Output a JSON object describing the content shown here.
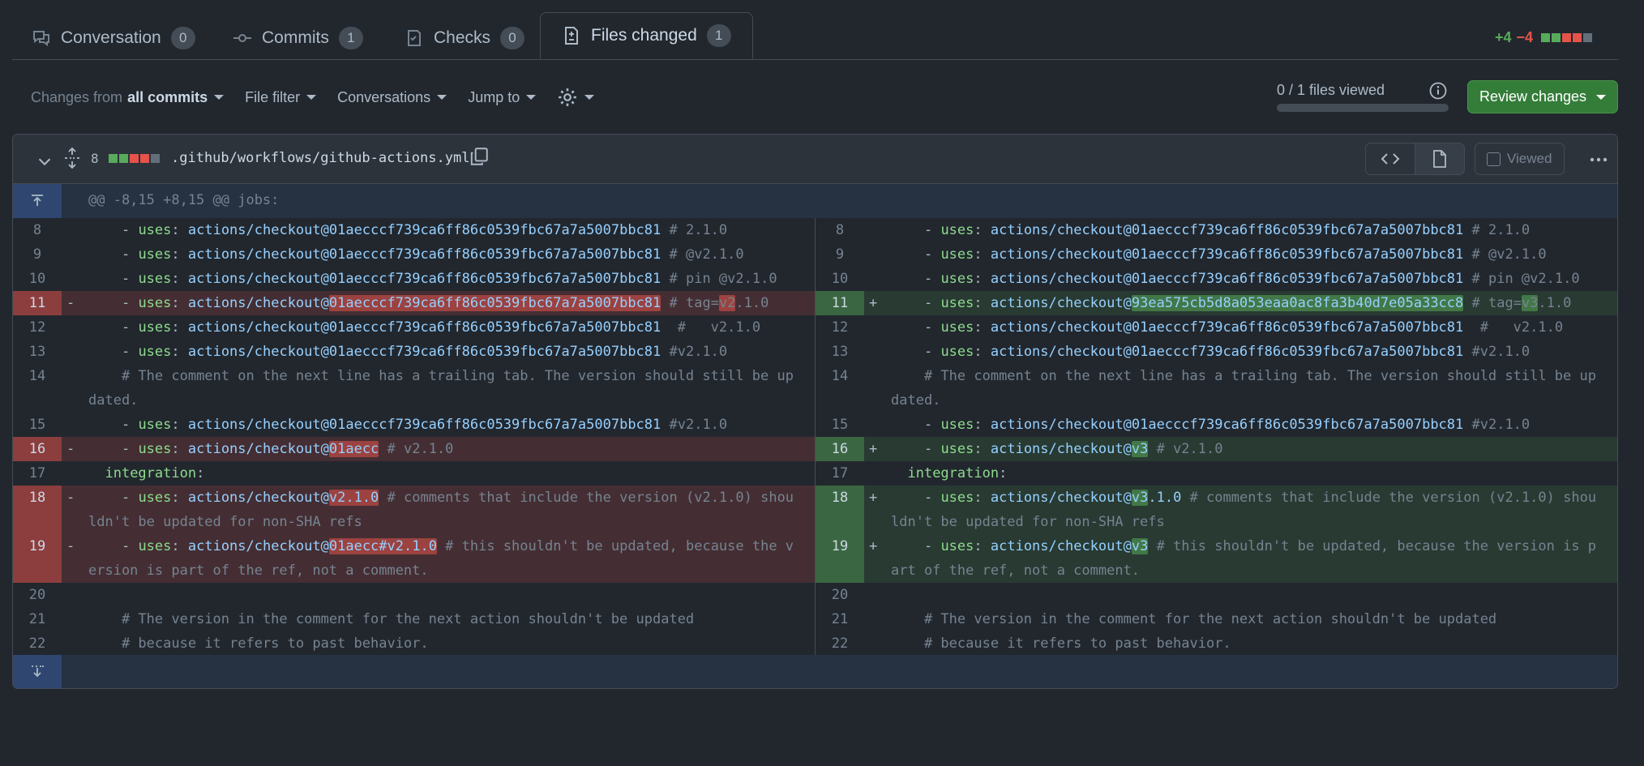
{
  "tabs": [
    {
      "label": "Conversation",
      "count": "0",
      "icon": "comment-discussion-icon"
    },
    {
      "label": "Commits",
      "count": "1",
      "icon": "git-commit-icon"
    },
    {
      "label": "Checks",
      "count": "0",
      "icon": "checklist-icon"
    },
    {
      "label": "Files changed",
      "count": "1",
      "icon": "file-diff-icon",
      "active": true
    }
  ],
  "diffstat": {
    "additions": "+4",
    "deletions": "−4"
  },
  "toolbar": {
    "changes_prefix": "Changes from",
    "changes_value": "all commits",
    "file_filter": "File filter",
    "conversations": "Conversations",
    "jump_to": "Jump to"
  },
  "files_viewed": {
    "label": "0 / 1 files viewed",
    "fraction": 0
  },
  "review_button": "Review changes",
  "file": {
    "change_count": "8",
    "path": ".github/workflows/github-actions.yml",
    "viewed_label": "Viewed"
  },
  "hunk_header": "@@ -8,15 +8,15 @@ jobs:",
  "lines_left": [
    {
      "n": "8",
      "t": "ctx",
      "parts": [
        [
          "p",
          "    - "
        ],
        [
          "k",
          "uses"
        ],
        [
          "p",
          ": "
        ],
        [
          "s",
          "actions/checkout@01aecccf739ca6ff86c0539fbc67a7a5007bbc81"
        ],
        [
          "c",
          " # 2.1.0"
        ]
      ]
    },
    {
      "n": "9",
      "t": "ctx",
      "parts": [
        [
          "p",
          "    - "
        ],
        [
          "k",
          "uses"
        ],
        [
          "p",
          ": "
        ],
        [
          "s",
          "actions/checkout@01aecccf739ca6ff86c0539fbc67a7a5007bbc81"
        ],
        [
          "c",
          " # @v2.1.0"
        ]
      ]
    },
    {
      "n": "10",
      "t": "ctx",
      "parts": [
        [
          "p",
          "    - "
        ],
        [
          "k",
          "uses"
        ],
        [
          "p",
          ": "
        ],
        [
          "s",
          "actions/checkout@01aecccf739ca6ff86c0539fbc67a7a5007bbc81"
        ],
        [
          "c",
          " # pin @v2.1.0"
        ]
      ]
    },
    {
      "n": "11",
      "t": "del",
      "parts": [
        [
          "p",
          "    - "
        ],
        [
          "k",
          "uses"
        ],
        [
          "p",
          ": "
        ],
        [
          "s",
          "actions/checkout@"
        ],
        [
          "sd",
          "01aecccf739ca6ff86c0539fbc67a7a5007bbc81"
        ],
        [
          "c",
          " # tag="
        ],
        [
          "cd",
          "v2"
        ],
        [
          "c",
          ".1.0"
        ]
      ]
    },
    {
      "n": "12",
      "t": "ctx",
      "parts": [
        [
          "p",
          "    - "
        ],
        [
          "k",
          "uses"
        ],
        [
          "p",
          ": "
        ],
        [
          "s",
          "actions/checkout@01aecccf739ca6ff86c0539fbc67a7a5007bbc81"
        ],
        [
          "c",
          "  #   v2.1.0"
        ]
      ]
    },
    {
      "n": "13",
      "t": "ctx",
      "parts": [
        [
          "p",
          "    - "
        ],
        [
          "k",
          "uses"
        ],
        [
          "p",
          ": "
        ],
        [
          "s",
          "actions/checkout@01aecccf739ca6ff86c0539fbc67a7a5007bbc81"
        ],
        [
          "c",
          " #v2.1.0"
        ]
      ]
    },
    {
      "n": "14",
      "t": "ctx",
      "rows": 2,
      "parts": [
        [
          "c",
          "    # The comment on the next line has a trailing tab. The version should still be updated."
        ]
      ]
    },
    {
      "n": "15",
      "t": "ctx",
      "parts": [
        [
          "p",
          "    - "
        ],
        [
          "k",
          "uses"
        ],
        [
          "p",
          ": "
        ],
        [
          "s",
          "actions/checkout@01aecccf739ca6ff86c0539fbc67a7a5007bbc81"
        ],
        [
          "c",
          " #v2.1.0"
        ]
      ]
    },
    {
      "n": "16",
      "t": "del",
      "parts": [
        [
          "p",
          "    - "
        ],
        [
          "k",
          "uses"
        ],
        [
          "p",
          ": "
        ],
        [
          "s",
          "actions/checkout@"
        ],
        [
          "sd",
          "01aecc"
        ],
        [
          "c",
          " # v2.1.0"
        ]
      ]
    },
    {
      "n": "17",
      "t": "ctx",
      "parts": [
        [
          "p",
          "  "
        ],
        [
          "k",
          "integration"
        ],
        [
          "p",
          ":"
        ]
      ]
    },
    {
      "n": "18",
      "t": "del",
      "rows": 2,
      "parts": [
        [
          "p",
          "    - "
        ],
        [
          "k",
          "uses"
        ],
        [
          "p",
          ": "
        ],
        [
          "s",
          "actions/checkout@"
        ],
        [
          "sd",
          "v2.1.0"
        ],
        [
          "c",
          " # comments that include the version (v2.1.0) shouldn't be updated for non-SHA refs"
        ]
      ]
    },
    {
      "n": "19",
      "t": "del",
      "rows": 2,
      "parts": [
        [
          "p",
          "    - "
        ],
        [
          "k",
          "uses"
        ],
        [
          "p",
          ": "
        ],
        [
          "s",
          "actions/checkout@"
        ],
        [
          "sd",
          "01aecc#v2.1.0"
        ],
        [
          "c",
          " # this shouldn't be updated, because the version is part of the ref, not a comment."
        ]
      ]
    },
    {
      "n": "20",
      "t": "ctx",
      "parts": [
        [
          "p",
          ""
        ]
      ]
    },
    {
      "n": "21",
      "t": "ctx",
      "parts": [
        [
          "c",
          "    # The version in the comment for the next action shouldn't be updated"
        ]
      ]
    },
    {
      "n": "22",
      "t": "ctx",
      "parts": [
        [
          "c",
          "    # because it refers to past behavior."
        ]
      ]
    }
  ],
  "lines_right": [
    {
      "n": "8",
      "t": "ctx",
      "parts": [
        [
          "p",
          "    - "
        ],
        [
          "k",
          "uses"
        ],
        [
          "p",
          ": "
        ],
        [
          "s",
          "actions/checkout@01aecccf739ca6ff86c0539fbc67a7a5007bbc81"
        ],
        [
          "c",
          " # 2.1.0"
        ]
      ]
    },
    {
      "n": "9",
      "t": "ctx",
      "parts": [
        [
          "p",
          "    - "
        ],
        [
          "k",
          "uses"
        ],
        [
          "p",
          ": "
        ],
        [
          "s",
          "actions/checkout@01aecccf739ca6ff86c0539fbc67a7a5007bbc81"
        ],
        [
          "c",
          " # @v2.1.0"
        ]
      ]
    },
    {
      "n": "10",
      "t": "ctx",
      "parts": [
        [
          "p",
          "    - "
        ],
        [
          "k",
          "uses"
        ],
        [
          "p",
          ": "
        ],
        [
          "s",
          "actions/checkout@01aecccf739ca6ff86c0539fbc67a7a5007bbc81"
        ],
        [
          "c",
          " # pin @v2.1.0"
        ]
      ]
    },
    {
      "n": "11",
      "t": "add",
      "parts": [
        [
          "p",
          "    - "
        ],
        [
          "k",
          "uses"
        ],
        [
          "p",
          ": "
        ],
        [
          "s",
          "actions/checkout@"
        ],
        [
          "sa",
          "93ea575cb5d8a053eaa0ac8fa3b40d7e05a33cc8"
        ],
        [
          "c",
          " # tag="
        ],
        [
          "ca",
          "v3"
        ],
        [
          "c",
          ".1.0"
        ]
      ]
    },
    {
      "n": "12",
      "t": "ctx",
      "parts": [
        [
          "p",
          "    - "
        ],
        [
          "k",
          "uses"
        ],
        [
          "p",
          ": "
        ],
        [
          "s",
          "actions/checkout@01aecccf739ca6ff86c0539fbc67a7a5007bbc81"
        ],
        [
          "c",
          "  #   v2.1.0"
        ]
      ]
    },
    {
      "n": "13",
      "t": "ctx",
      "parts": [
        [
          "p",
          "    - "
        ],
        [
          "k",
          "uses"
        ],
        [
          "p",
          ": "
        ],
        [
          "s",
          "actions/checkout@01aecccf739ca6ff86c0539fbc67a7a5007bbc81"
        ],
        [
          "c",
          " #v2.1.0"
        ]
      ]
    },
    {
      "n": "14",
      "t": "ctx",
      "rows": 2,
      "parts": [
        [
          "c",
          "    # The comment on the next line has a trailing tab. The version should still be updated."
        ]
      ]
    },
    {
      "n": "15",
      "t": "ctx",
      "parts": [
        [
          "p",
          "    - "
        ],
        [
          "k",
          "uses"
        ],
        [
          "p",
          ": "
        ],
        [
          "s",
          "actions/checkout@01aecccf739ca6ff86c0539fbc67a7a5007bbc81"
        ],
        [
          "c",
          " #v2.1.0"
        ]
      ]
    },
    {
      "n": "16",
      "t": "add",
      "parts": [
        [
          "p",
          "    - "
        ],
        [
          "k",
          "uses"
        ],
        [
          "p",
          ": "
        ],
        [
          "s",
          "actions/checkout@"
        ],
        [
          "sa",
          "v3"
        ],
        [
          "c",
          " # v2.1.0"
        ]
      ]
    },
    {
      "n": "17",
      "t": "ctx",
      "parts": [
        [
          "p",
          "  "
        ],
        [
          "k",
          "integration"
        ],
        [
          "p",
          ":"
        ]
      ]
    },
    {
      "n": "18",
      "t": "add",
      "rows": 2,
      "parts": [
        [
          "p",
          "    - "
        ],
        [
          "k",
          "uses"
        ],
        [
          "p",
          ": "
        ],
        [
          "s",
          "actions/checkout@"
        ],
        [
          "sa",
          "v3"
        ],
        [
          "s",
          ".1.0"
        ],
        [
          "c",
          " # comments that include the version (v2.1.0) shouldn't be updated for non-SHA refs"
        ]
      ]
    },
    {
      "n": "19",
      "t": "add",
      "rows": 2,
      "parts": [
        [
          "p",
          "    - "
        ],
        [
          "k",
          "uses"
        ],
        [
          "p",
          ": "
        ],
        [
          "s",
          "actions/checkout@"
        ],
        [
          "sa",
          "v3"
        ],
        [
          "c",
          " # this shouldn't be updated, because the version is part of the ref, not a comment."
        ]
      ]
    },
    {
      "n": "20",
      "t": "ctx",
      "parts": [
        [
          "p",
          ""
        ]
      ]
    },
    {
      "n": "21",
      "t": "ctx",
      "parts": [
        [
          "c",
          "    # The version in the comment for the next action shouldn't be updated"
        ]
      ]
    },
    {
      "n": "22",
      "t": "ctx",
      "parts": [
        [
          "c",
          "    # because it refers to past behavior."
        ]
      ]
    }
  ],
  "colors": {
    "added": "#57ab5a",
    "deleted": "#e5534b",
    "accent": "#347d39"
  }
}
